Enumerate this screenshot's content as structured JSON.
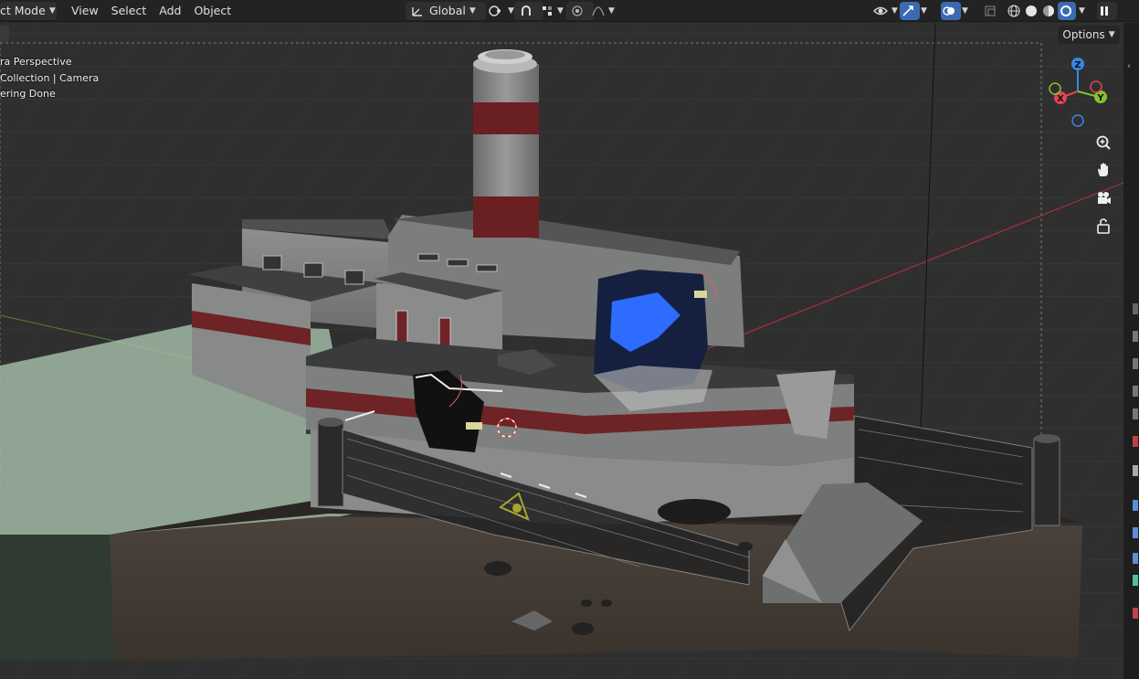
{
  "header": {
    "mode_label": "ct Mode",
    "menus": [
      "View",
      "Select",
      "Add",
      "Object"
    ],
    "transform_orientation": "Global"
  },
  "viewport": {
    "overlay": {
      "line1": "ra Perspective",
      "line2": "Collection | Camera",
      "line3": "ering Done"
    },
    "options_label": "Options",
    "gizmo": {
      "z": "Z",
      "x": "X",
      "y": "Y"
    }
  },
  "colors": {
    "header_bg": "#232323",
    "viewport_bg": "#2e2e2e",
    "accent_blue": "#3b6ab3",
    "axis_x": "#e2454f",
    "axis_y": "#86c32c",
    "axis_z": "#3a86e6",
    "grid_red": "#a8303a"
  },
  "icons": [
    "transform-orientation-icon",
    "pivot-icon",
    "snap-icon",
    "snap-target-icon",
    "proportional-edit-icon",
    "falloff-icon",
    "visibility-icon",
    "gizmo-icon",
    "overlay-icon",
    "xray-icon",
    "wireframe-shading-icon",
    "solid-shading-icon",
    "material-shading-icon",
    "rendered-shading-icon",
    "pause-icon",
    "zoom-icon",
    "hand-pan-icon",
    "camera-view-icon",
    "lock-icon"
  ]
}
